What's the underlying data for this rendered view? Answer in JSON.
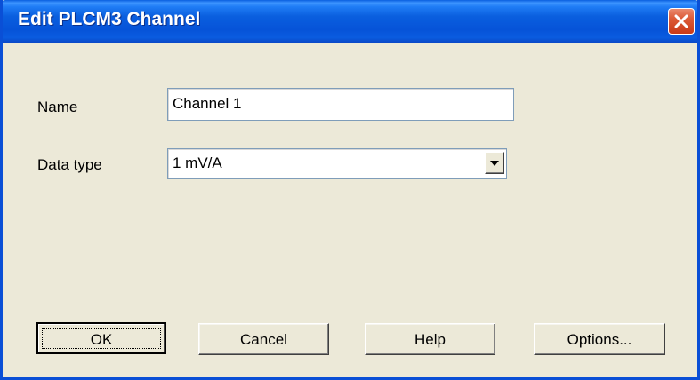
{
  "window": {
    "title": "Edit PLCM3 Channel"
  },
  "form": {
    "name_label": "Name",
    "name_value": "Channel 1",
    "data_type_label": "Data type",
    "data_type_value": "1 mV/A"
  },
  "buttons": {
    "ok": "OK",
    "cancel": "Cancel",
    "help": "Help",
    "options": "Options..."
  },
  "icons": {
    "close": "close-icon",
    "dropdown": "chevron-down-icon"
  },
  "colors": {
    "titlebar": "#0a5fdf",
    "close_button": "#dc5a37",
    "dialog_background": "#ece9d8"
  }
}
